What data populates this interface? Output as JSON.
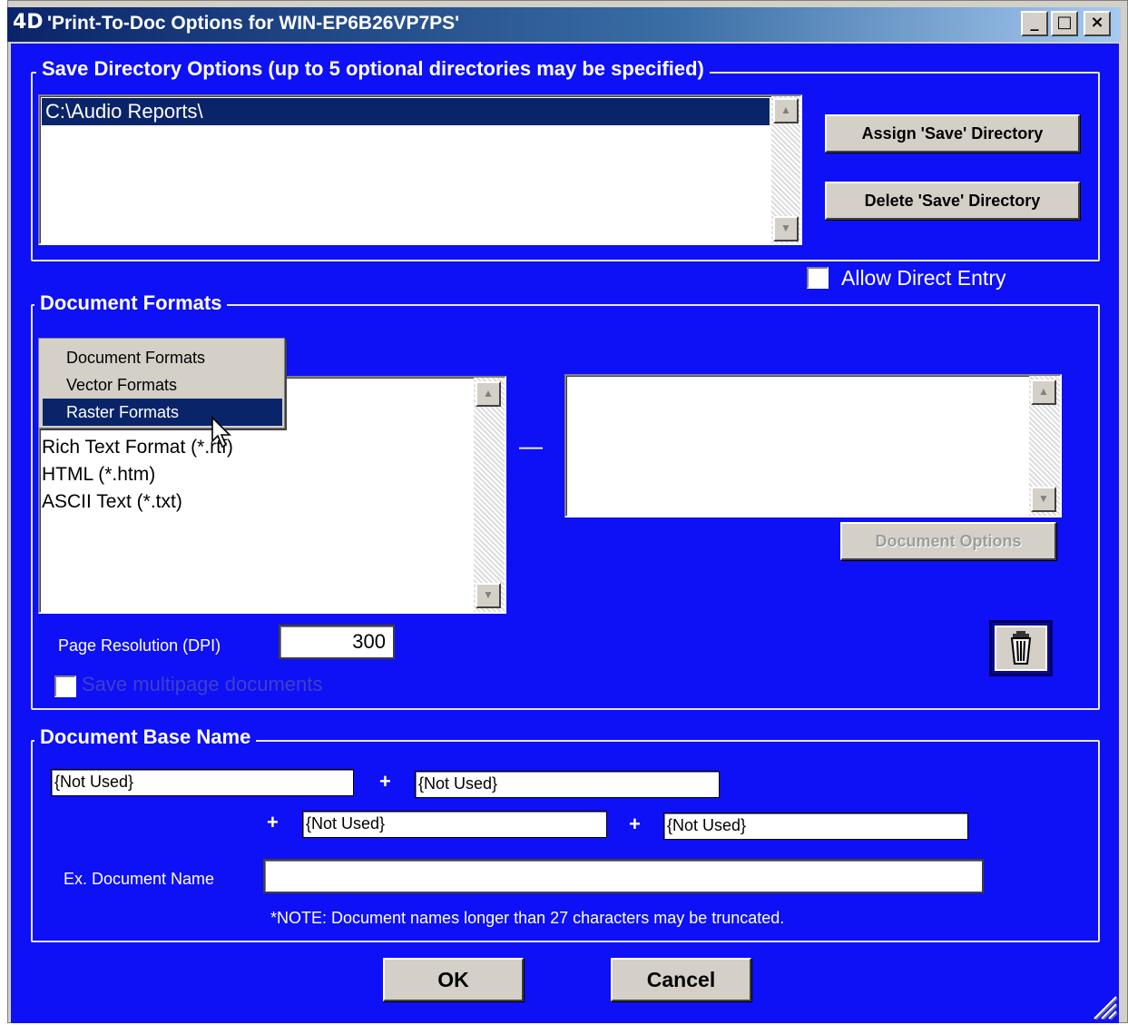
{
  "window": {
    "title": "'Print-To-Doc Options for WIN-EP6B26VP7PS'",
    "logo": "4D",
    "minimize": "_",
    "maximize": "□",
    "close": "×"
  },
  "save_dir": {
    "legend": "Save Directory Options (up to 5 optional directories may be specified)",
    "items": [
      "C:\\Audio Reports\\"
    ],
    "assign_button": "Assign 'Save' Directory",
    "delete_button": "Delete 'Save' Directory",
    "allow_direct_entry": "Allow Direct Entry"
  },
  "doc_formats": {
    "legend": "Document Formats",
    "popup_options": [
      "Document Formats",
      "Vector Formats",
      "Raster Formats"
    ],
    "popup_highlighted": "Raster Formats",
    "formats": [
      "Rich Text Format (*.rtf)",
      "HTML (*.htm)",
      "ASCII Text (*.txt)"
    ],
    "dash": "—",
    "document_options_button": "Document Options",
    "resolution_label": "Page Resolution (DPI)",
    "resolution_value": "300",
    "multipage_label": "Save multipage documents",
    "trash_icon": "trash-icon"
  },
  "base_name": {
    "legend": "Document Base Name",
    "fields": [
      "{Not Used}",
      "{Not Used}",
      "{Not Used}",
      "{Not Used}"
    ],
    "plus": "+",
    "example_label": "Ex. Document Name",
    "example_value": "",
    "note": "*NOTE: Document names longer than 27 characters may be truncated."
  },
  "buttons": {
    "ok": "OK",
    "cancel": "Cancel"
  }
}
